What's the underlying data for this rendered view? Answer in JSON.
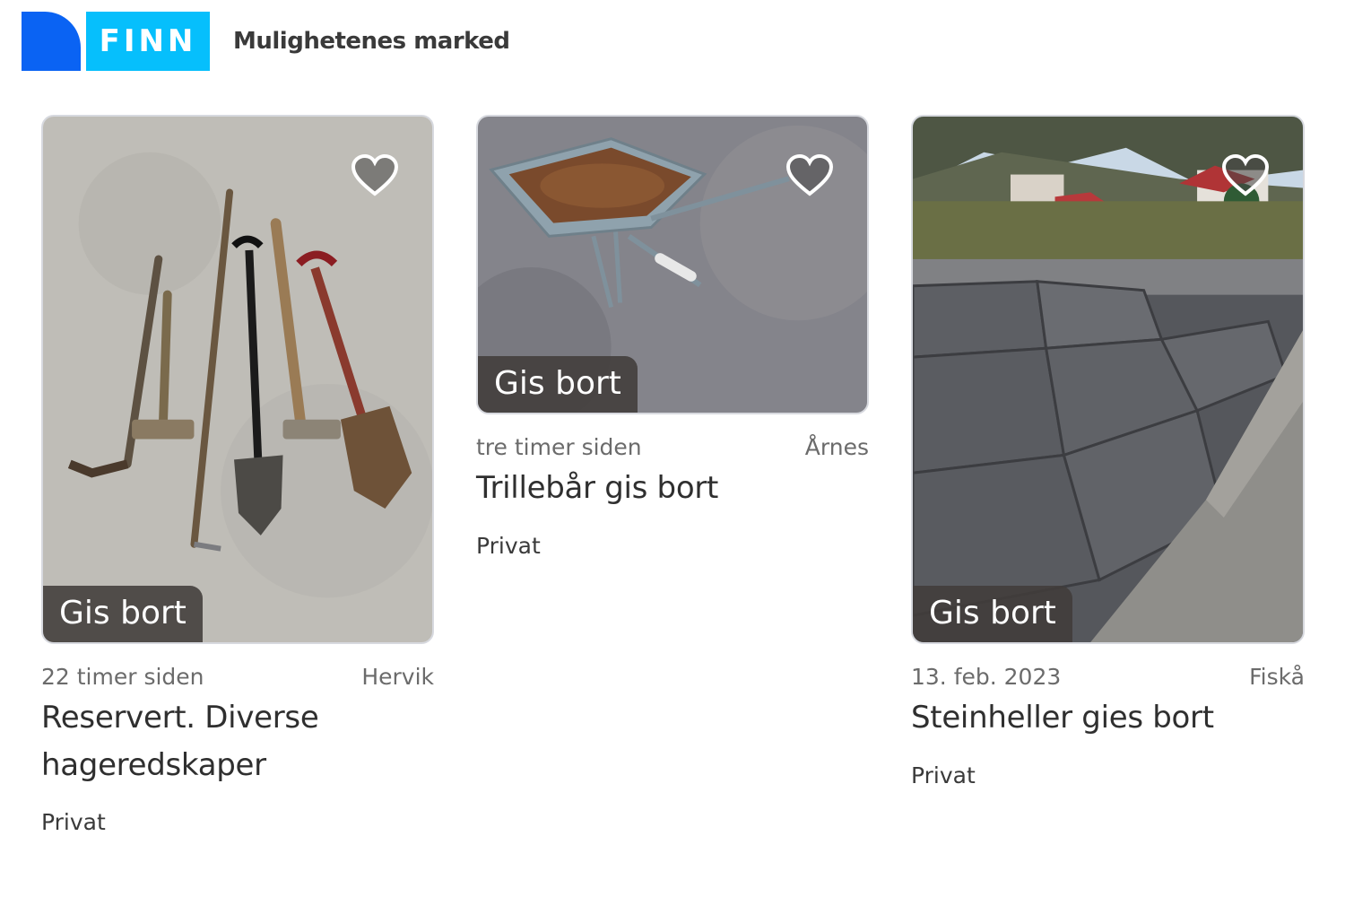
{
  "header": {
    "logo_text": "FINN",
    "tagline": "Mulighetenes marked",
    "colors": {
      "logo_dark": "#0a63f3",
      "logo_light": "#06bffc"
    }
  },
  "listings": [
    {
      "badge": "Gis bort",
      "time": "22 timer siden",
      "location": "Hervik",
      "title": "Reservert. Diverse hageredskaper",
      "seller": "Privat",
      "favorite_icon": "heart-outline-icon",
      "image": "garden-tools-photo"
    },
    {
      "badge": "Gis bort",
      "time": "tre timer siden",
      "location": "Årnes",
      "title": "Trillebår gis bort",
      "seller": "Privat",
      "favorite_icon": "heart-outline-icon",
      "image": "wheelbarrow-photo"
    },
    {
      "badge": "Gis bort",
      "time": "13. feb. 2023",
      "location": "Fiskå",
      "title": "Steinheller gies bort",
      "seller": "Privat",
      "favorite_icon": "heart-outline-icon",
      "image": "paving-stones-photo"
    }
  ]
}
